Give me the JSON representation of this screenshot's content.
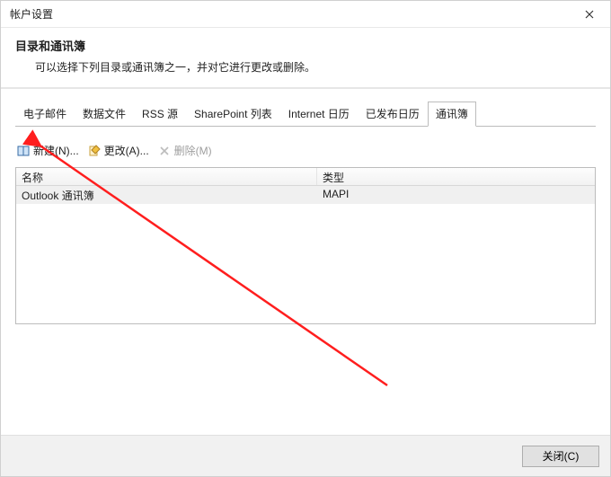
{
  "titlebar": {
    "title": "帐户设置"
  },
  "header": {
    "heading": "目录和通讯簿",
    "sub": "可以选择下列目录或通讯簿之一，并对它进行更改或删除。"
  },
  "tabs": {
    "items": [
      {
        "label": "电子邮件"
      },
      {
        "label": "数据文件"
      },
      {
        "label": "RSS 源"
      },
      {
        "label": "SharePoint 列表"
      },
      {
        "label": "Internet 日历"
      },
      {
        "label": "已发布日历"
      },
      {
        "label": "通讯簿"
      }
    ],
    "active_index": 6
  },
  "toolbar": {
    "new_label": "新建(N)...",
    "edit_label": "更改(A)...",
    "delete_label": "删除(M)"
  },
  "table": {
    "columns": {
      "name": "名称",
      "type": "类型"
    },
    "rows": [
      {
        "name": "Outlook 通讯簿",
        "type": "MAPI"
      }
    ]
  },
  "footer": {
    "close_label": "关闭(C)"
  }
}
